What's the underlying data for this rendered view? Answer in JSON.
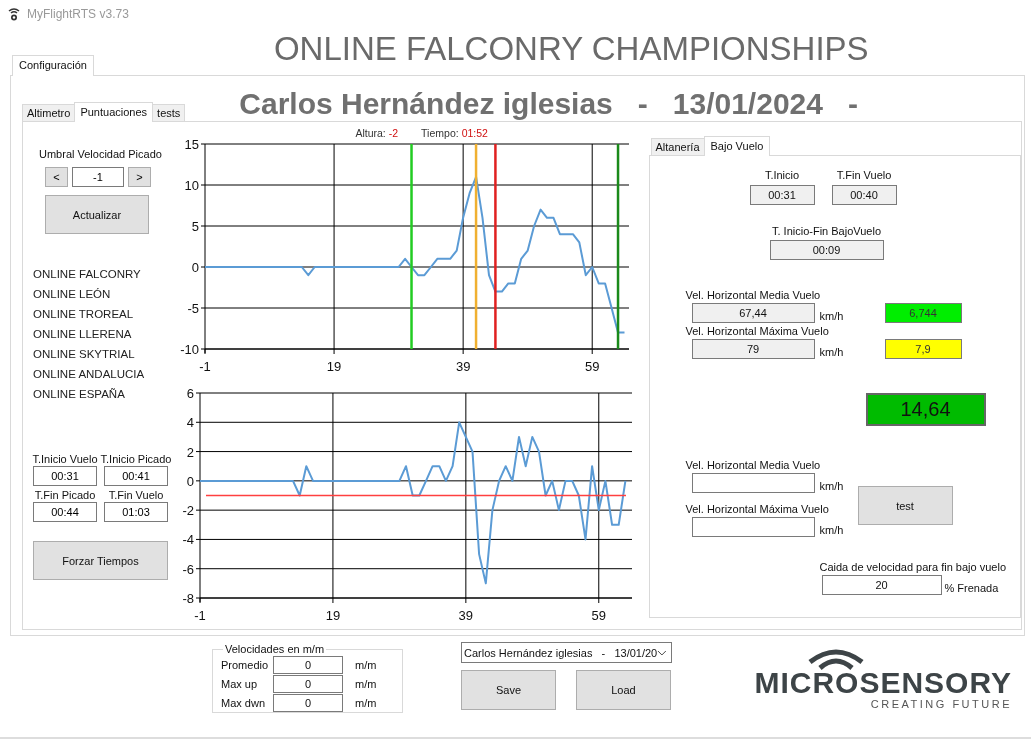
{
  "window": {
    "title": "MyFlightRTS v3.73"
  },
  "heading": "ONLINE FALCONRY CHAMPIONSHIPS",
  "outer_tabs": [
    {
      "label": "Configuración",
      "selected": true
    }
  ],
  "subtitle": "Carlos Hernández iglesias   -   13/01/2024   -",
  "inner_tabs": [
    {
      "label": "Altimetro",
      "selected": false
    },
    {
      "label": "Puntuaciones",
      "selected": true
    },
    {
      "label": "tests",
      "selected": false
    }
  ],
  "threshold": {
    "label": "Umbral Velocidad Picado",
    "decrement": "<",
    "value": "-1",
    "increment": ">"
  },
  "update_button": "Actualizar",
  "championships": [
    "ONLINE FALCONRY",
    "ONLINE LEÓN",
    "ONLINE TROREAL",
    "ONLINE LLERENA",
    "ONLINE SKYTRIAL",
    "ONLINE ANDALUCIA",
    "ONLINE ESPAÑA"
  ],
  "times": [
    {
      "label": "T.Inicio Vuelo",
      "value": "00:31"
    },
    {
      "label": "T.Inicio Picado",
      "value": "00:41"
    },
    {
      "label": "T.Fin Picado",
      "value": "00:44"
    },
    {
      "label": "T.Fin Vuelo",
      "value": "01:03"
    }
  ],
  "force_button": "Forzar Tiempos",
  "readout": {
    "altura_label": "Altura:",
    "altura": "-2",
    "tiempo_label": "Tiempo:",
    "tiempo": "01:52"
  },
  "charts": [
    {
      "chart_data": {
        "type": "line",
        "x": [
          -1,
          0,
          1,
          2,
          3,
          4,
          5,
          6,
          7,
          8,
          9,
          10,
          11,
          12,
          13,
          14,
          15,
          16,
          17,
          18,
          19,
          20,
          21,
          22,
          23,
          24,
          25,
          26,
          27,
          28,
          29,
          30,
          31,
          32,
          33,
          34,
          35,
          36,
          37,
          38,
          39,
          40,
          41,
          42,
          43,
          44,
          45,
          46,
          47,
          48,
          49,
          50,
          51,
          52,
          53,
          54,
          55,
          56,
          57,
          58,
          59,
          60,
          61,
          62,
          63,
          64
        ],
        "grid": true,
        "series": [
          {
            "color": "#5b9bd5",
            "values": [
              0,
              0,
              0,
              0,
              0,
              0,
              0,
              0,
              0,
              0,
              0,
              0,
              0,
              0,
              0,
              0,
              -1,
              0,
              0,
              0,
              0,
              0,
              0,
              0,
              0,
              0,
              0,
              0,
              0,
              0,
              0,
              1,
              0,
              -1,
              -1,
              0,
              1,
              1,
              1,
              2,
              6,
              9,
              11,
              6,
              -1,
              -3,
              -3,
              -2,
              -2,
              1,
              2,
              5,
              7,
              6,
              6,
              4,
              4,
              4,
              3,
              -1,
              0,
              -2,
              -2,
              -5,
              -8,
              -8
            ]
          }
        ],
        "xlim": [
          -1,
          64.7
        ],
        "ylim": [
          -10,
          15
        ],
        "xticks": [
          -1,
          19,
          39,
          59
        ],
        "yticks": [
          -10,
          -5,
          0,
          5,
          10,
          15
        ],
        "ref_lines": [
          {
            "axis": "x",
            "value": 31,
            "color": "#22cc22"
          },
          {
            "axis": "x",
            "value": 41,
            "color": "#f0b030"
          },
          {
            "axis": "x",
            "value": 44,
            "color": "#e02020"
          },
          {
            "axis": "x",
            "value": 63,
            "color": "#1a8a1a"
          }
        ]
      }
    },
    {
      "chart_data": {
        "type": "line",
        "x": [
          -1,
          0,
          1,
          2,
          3,
          4,
          5,
          6,
          7,
          8,
          9,
          10,
          11,
          12,
          13,
          14,
          15,
          16,
          17,
          18,
          19,
          20,
          21,
          22,
          23,
          24,
          25,
          26,
          27,
          28,
          29,
          30,
          31,
          32,
          33,
          34,
          35,
          36,
          37,
          38,
          39,
          40,
          41,
          42,
          43,
          44,
          45,
          46,
          47,
          48,
          49,
          50,
          51,
          52,
          53,
          54,
          55,
          56,
          57,
          58,
          59,
          60,
          61,
          62,
          63
        ],
        "grid": true,
        "series": [
          {
            "color": "#5b9bd5",
            "values": [
              0,
              0,
              0,
              0,
              0,
              0,
              0,
              0,
              0,
              0,
              0,
              0,
              0,
              0,
              0,
              -1,
              1,
              0,
              0,
              0,
              0,
              0,
              0,
              0,
              0,
              0,
              0,
              0,
              0,
              0,
              0,
              1,
              -1,
              -1,
              0,
              1,
              1,
              0,
              1,
              4,
              3,
              2,
              -5,
              -7,
              -2,
              0,
              1,
              0,
              3,
              1,
              3,
              2,
              -1,
              0,
              -2,
              0,
              0,
              -1,
              -4,
              1,
              -2,
              0,
              -3,
              -3,
              0
            ]
          }
        ],
        "xlim": [
          -1,
          64
        ],
        "ylim": [
          -8,
          6
        ],
        "xticks": [
          -1,
          19,
          39,
          59
        ],
        "yticks": [
          -8,
          -6,
          -4,
          -2,
          0,
          2,
          4,
          6
        ],
        "ref_lines": [
          {
            "axis": "y",
            "value": -1,
            "color": "#ff4040"
          }
        ]
      }
    }
  ],
  "right_tabs": [
    {
      "label": "Altanería",
      "selected": false
    },
    {
      "label": "Bajo Vuelo",
      "selected": true
    }
  ],
  "bajo_vuelo": {
    "start": {
      "label": "T.Inicio",
      "value": "00:31"
    },
    "end": {
      "label": "T.Fin Vuelo",
      "value": "00:40"
    },
    "duration": {
      "label": "T. Inicio-Fin BajoVuelo",
      "value": "00:09"
    },
    "speeds": [
      {
        "label": "Vel. Horizontal Media Vuelo",
        "value": "67,44",
        "unit": "km/h",
        "score": "6,744",
        "color": "#00ee00"
      },
      {
        "label": "Vel. Horizontal Máxima Vuelo",
        "value": "79",
        "unit": "km/h",
        "score": "7,9",
        "color": "#ffff00"
      }
    ],
    "total": {
      "value": "14,64",
      "color": "#00bb00"
    },
    "test_speeds": [
      {
        "label": "Vel. Horizontal Media Vuelo",
        "unit": "km/h"
      },
      {
        "label": "Vel. Horizontal Máxima Vuelo",
        "unit": "km/h"
      }
    ],
    "test_button": "test",
    "drop": {
      "label": "Caida de velocidad para fin bajo vuelo",
      "value": "20",
      "unit": "% Frenada"
    }
  },
  "velocities": {
    "title": "Velocidades en m/m",
    "rows": [
      {
        "label": "Promedio",
        "value": "0",
        "unit": "m/m"
      },
      {
        "label": "Max up",
        "value": "0",
        "unit": "m/m"
      },
      {
        "label": "Max dwn",
        "value": "0",
        "unit": "m/m"
      }
    ]
  },
  "session_select": "Carlos Hernández iglesias   -   13/01/20",
  "save_button": "Save",
  "load_button": "Load",
  "logo": {
    "name": "MICROSENSORY",
    "tagline": "CREATING FUTURE"
  }
}
